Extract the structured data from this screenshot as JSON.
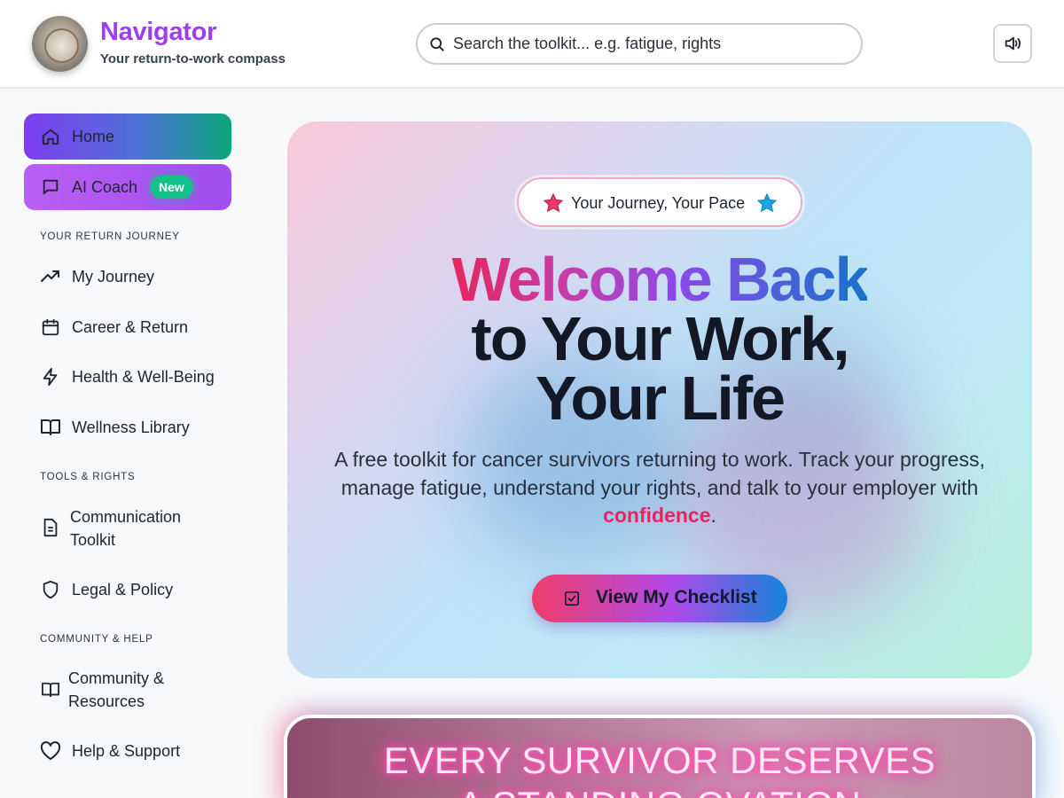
{
  "header": {
    "brand_title": "Navigator",
    "brand_subtitle": "Your return-to-work compass",
    "search_placeholder": "Search the toolkit... e.g. fatigue, rights",
    "icons": {
      "logo": "compass-logo",
      "search": "search-icon",
      "audio": "speaker-icon"
    }
  },
  "sidebar": {
    "home": {
      "label": "Home",
      "icon": "home-icon"
    },
    "coach": {
      "label": "AI Coach",
      "badge": "New",
      "icon": "chat-icon"
    },
    "sections": [
      {
        "label": "YOUR RETURN JOURNEY",
        "items": [
          {
            "label": "My Journey",
            "icon": "trend-up-icon"
          },
          {
            "label": "Career & Return",
            "icon": "calendar-icon"
          },
          {
            "label": "Health & Well-Being",
            "icon": "lightning-icon"
          },
          {
            "label": "Wellness Library",
            "icon": "book-icon"
          }
        ]
      },
      {
        "label": "TOOLS & RIGHTS",
        "items": [
          {
            "label": "Communication Toolkit",
            "icon": "document-icon"
          },
          {
            "label": "Legal & Policy",
            "icon": "shield-icon"
          }
        ]
      },
      {
        "label": "COMMUNITY & HELP",
        "items": [
          {
            "label": "Community & Resources",
            "icon": "book-icon"
          },
          {
            "label": "Help & Support",
            "icon": "heart-icon"
          }
        ]
      }
    ]
  },
  "hero": {
    "pill_text": "Your Journey, Your Pace",
    "title_line1": "Welcome Back",
    "title_line2": "to Your Work,",
    "title_line3": "Your Life",
    "description_before": "A free toolkit for cancer survivors returning to work. Track your progress, manage fatigue, understand your rights, and talk to your employer with ",
    "description_highlight": "confidence",
    "description_after": ".",
    "cta_label": "View My Checklist"
  },
  "banner": {
    "line1": "EVERY SURVIVOR DESERVES",
    "line2": "A STANDING OVATION"
  },
  "colors": {
    "brand": "#9b3ff0",
    "accent_pink": "#e5265e",
    "badge_green": "#13c08a"
  }
}
